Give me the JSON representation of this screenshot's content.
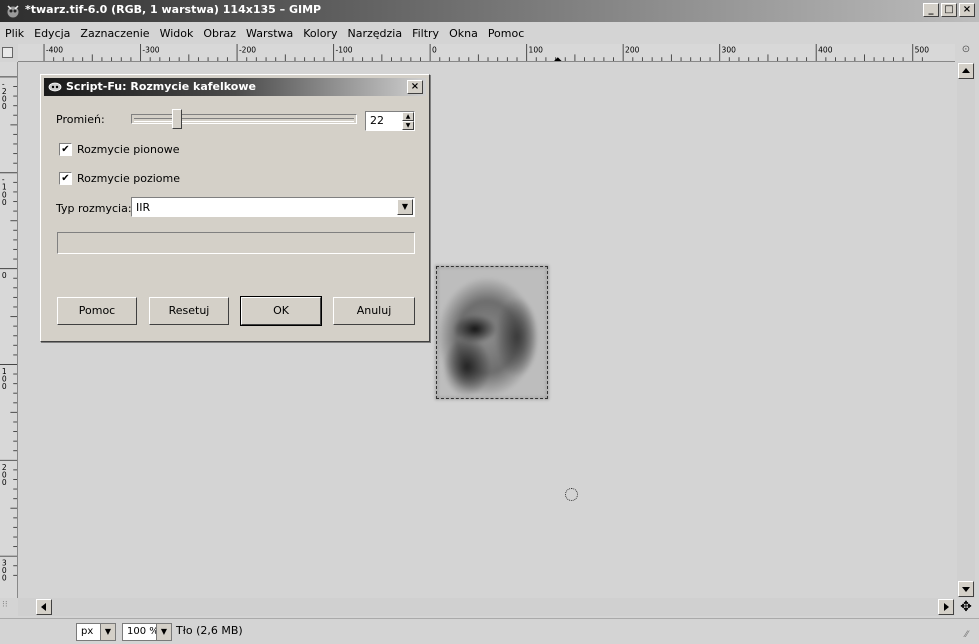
{
  "window": {
    "title": "*twarz.tif-6.0 (RGB, 1 warstwa) 114x135 – GIMP",
    "btn_minimize": "_",
    "btn_maximize": "□",
    "btn_close": "×"
  },
  "menu": [
    {
      "label": "Plik"
    },
    {
      "label": "Edycja"
    },
    {
      "label": "Zaznaczenie"
    },
    {
      "label": "Widok"
    },
    {
      "label": "Obraz"
    },
    {
      "label": "Warstwa"
    },
    {
      "label": "Kolory"
    },
    {
      "label": "Narzędzia"
    },
    {
      "label": "Filtry"
    },
    {
      "label": "Okna"
    },
    {
      "label": "Pomoc"
    }
  ],
  "hruler_labels": [
    "-400",
    "-300",
    "-200",
    "-100",
    "0",
    "100",
    "200",
    "300",
    "400",
    "500"
  ],
  "vruler_labels": [
    "-200",
    "-100",
    "0",
    "100",
    "200",
    "300"
  ],
  "dialog": {
    "title": "Script-Fu: Rozmycie kafelkowe",
    "radius_label": "Promień:",
    "radius_value": "22",
    "radius_fraction": 0.19,
    "check_vertical_label": "Rozmycie pionowe",
    "check_vertical": true,
    "check_horizontal_label": "Rozmycie poziome",
    "check_horizontal": true,
    "blur_type_label": "Typ rozmycia:",
    "blur_type_value": "IIR",
    "buttons": {
      "help": "Pomoc",
      "reset": "Resetuj",
      "ok": "OK",
      "cancel": "Anuluj"
    }
  },
  "status": {
    "unit": "px",
    "zoom": "100 %",
    "layer_info": "Tło (2,6 MB)"
  }
}
